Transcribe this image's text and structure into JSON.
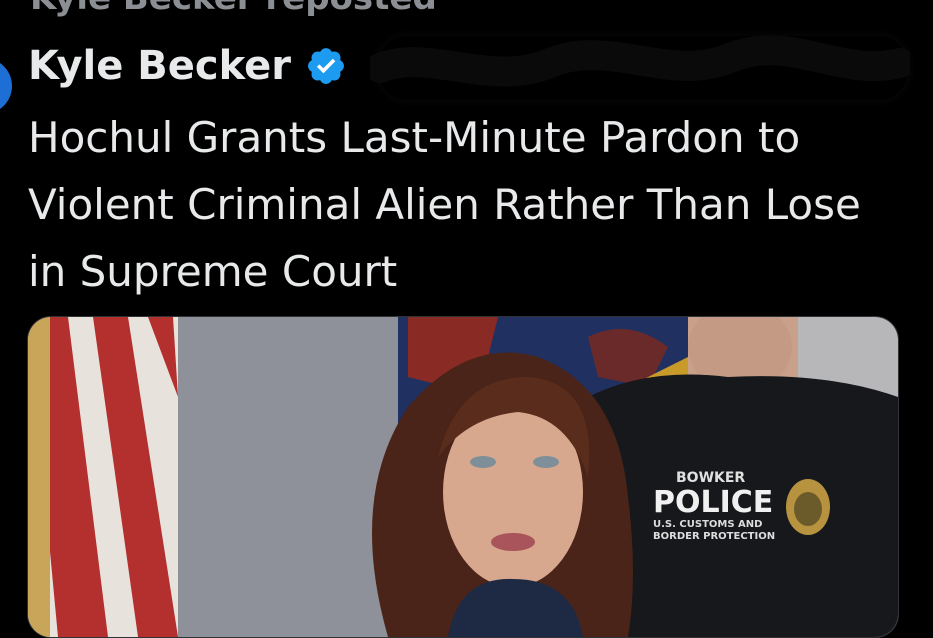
{
  "repost": {
    "text": "Kyle Becker reposted"
  },
  "post": {
    "author_name": "Kyle Becker",
    "headline": "Hochul Grants Last-Minute Pardon to Violent Criminal Alien Rather Than Lose in Supreme Court"
  },
  "media": {
    "uniform_name": "BOWKER",
    "uniform_title": "POLICE",
    "uniform_agency_line1": "U.S. CUSTOMS AND",
    "uniform_agency_line2": "BORDER PROTECTION"
  },
  "colors": {
    "background": "#000000",
    "text_primary": "#e7e9ea",
    "verified_badge": "#1d9bf0"
  },
  "icons": {
    "verified": "verified-badge-icon"
  }
}
